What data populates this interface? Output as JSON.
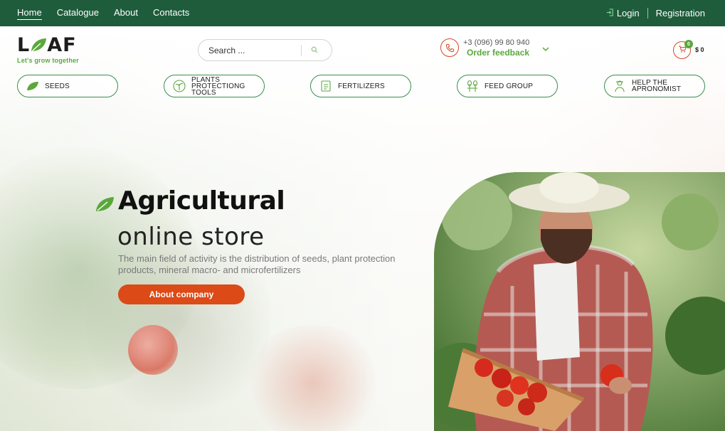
{
  "topnav": {
    "items": [
      "Home",
      "Catalogue",
      "About",
      "Contacts"
    ],
    "active": "Home"
  },
  "auth": {
    "login": "Login",
    "registration": "Registration"
  },
  "logo": {
    "word_left": "L",
    "word_right": "AF",
    "tagline": "Let's grow together"
  },
  "search": {
    "placeholder": "Search ..."
  },
  "contact": {
    "phone": "+3 (096) 99 80 940",
    "feedback": "Order feedback"
  },
  "cart": {
    "count": "0",
    "total": "$ 0"
  },
  "categories": [
    {
      "label": "SEEDS",
      "icon": "leaf-icon"
    },
    {
      "label": "PLANTS PROTECTIONG TOOLS",
      "icon": "plant-shield-icon"
    },
    {
      "label": "FERTILIZERS",
      "icon": "fertilizer-bag-icon"
    },
    {
      "label": "FEED GROUP",
      "icon": "wheat-icon"
    },
    {
      "label": "HELP THE APRONOMIST",
      "icon": "farmer-icon"
    }
  ],
  "hero": {
    "title": "Agricultural",
    "subtitle": "online store",
    "description": "The main field of activity is the distribution of seeds, plant protection products, mineral macro- and microfertilizers",
    "button": "About company"
  },
  "colors": {
    "topbar": "#1e5c3b",
    "brand_green": "#5aa83c",
    "accent_orange": "#db4a17",
    "category_border": "#3b8e4e"
  }
}
